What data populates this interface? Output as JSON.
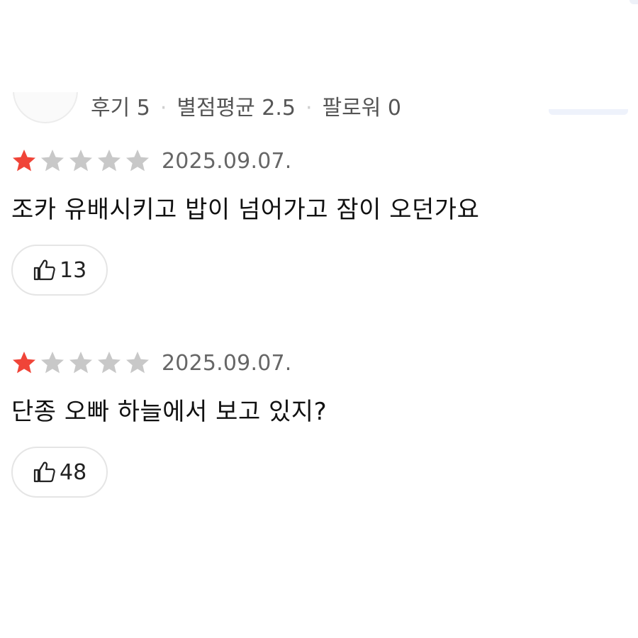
{
  "header": {
    "stats": [
      {
        "label": "후기 5"
      },
      {
        "label": "별점평균 2.5"
      },
      {
        "label": "팔로워 0"
      }
    ]
  },
  "reviews": [
    {
      "rating": 1,
      "max_rating": 5,
      "date": "2025.09.07.",
      "text": "조카 유배시키고 밥이 넘어가고 잠이 오던가요",
      "likes": "13"
    },
    {
      "rating": 1,
      "max_rating": 5,
      "date": "2025.09.07.",
      "text": "단종 오빠 하늘에서 보고 있지?",
      "likes": "48"
    }
  ],
  "colors": {
    "star_filled": "#f04438",
    "star_empty": "#c8c8c8",
    "date_text": "#666666",
    "border": "#e5e5e5"
  },
  "icons": {
    "star": "star-icon",
    "like": "thumbs-up-icon"
  }
}
